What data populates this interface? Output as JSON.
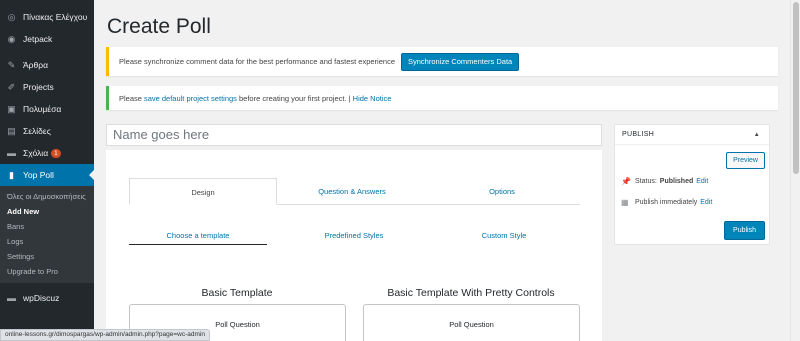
{
  "sidebar": {
    "items": [
      {
        "label": "Πίνακας Ελέγχου",
        "icon": "dashboard-icon",
        "glyph": "◎"
      },
      {
        "label": "Jetpack",
        "icon": "jetpack-icon",
        "glyph": "◉"
      },
      {
        "label": "Άρθρα",
        "icon": "pin-icon",
        "glyph": "✎"
      },
      {
        "label": "Projects",
        "icon": "projects-icon",
        "glyph": "✐"
      },
      {
        "label": "Πολυμέσα",
        "icon": "media-icon",
        "glyph": "▣"
      },
      {
        "label": "Σελίδες",
        "icon": "pages-icon",
        "glyph": "▤"
      },
      {
        "label": "Σχόλια",
        "icon": "comments-icon",
        "glyph": "▬",
        "badge": "1"
      },
      {
        "label": "Yop Poll",
        "icon": "poll-icon",
        "glyph": "▮"
      }
    ],
    "submenu": [
      "Όλες οι Δημοσκοπήσεις",
      "Add New",
      "Bans",
      "Logs",
      "Settings",
      "Upgrade to Pro"
    ],
    "after": {
      "label": "wpDiscuz",
      "icon": "discuss-icon",
      "glyph": "▬"
    }
  },
  "page": {
    "title": "Create Poll"
  },
  "notices": {
    "sync_text": "Please synchronize comment data for the best performance and fastest experience",
    "sync_button": "Synchronize Commenters Data",
    "settings_prefix": "Please ",
    "settings_link": "save default project settings",
    "settings_suffix": " before creating your first project. | ",
    "hide_link": "Hide Notice"
  },
  "poll": {
    "name_placeholder": "Name goes here"
  },
  "tabs": [
    "Design",
    "Question & Answers",
    "Options"
  ],
  "subtabs": [
    "Choose a template",
    "Predefined Styles",
    "Custom Style"
  ],
  "templates": [
    {
      "heading": "Basic Template",
      "card": "Poll Question"
    },
    {
      "heading": "Basic Template With Pretty Controls",
      "card": "Poll Question"
    }
  ],
  "publish": {
    "header": "PUBLISH",
    "preview": "Preview",
    "status_label": "Status:",
    "status_value": "Published",
    "status_edit": "Edit",
    "schedule_text": "Publish immediately",
    "schedule_edit": "Edit",
    "publish_button": "Publish"
  },
  "statusbar": {
    "url": "online-lessons.gr/dimospargas/wp-admin/admin.php?page=wc-admin"
  },
  "colors": {
    "sidebar": "#23282d",
    "accent": "#0073aa",
    "warning": "#ffb900",
    "success": "#46b450"
  }
}
